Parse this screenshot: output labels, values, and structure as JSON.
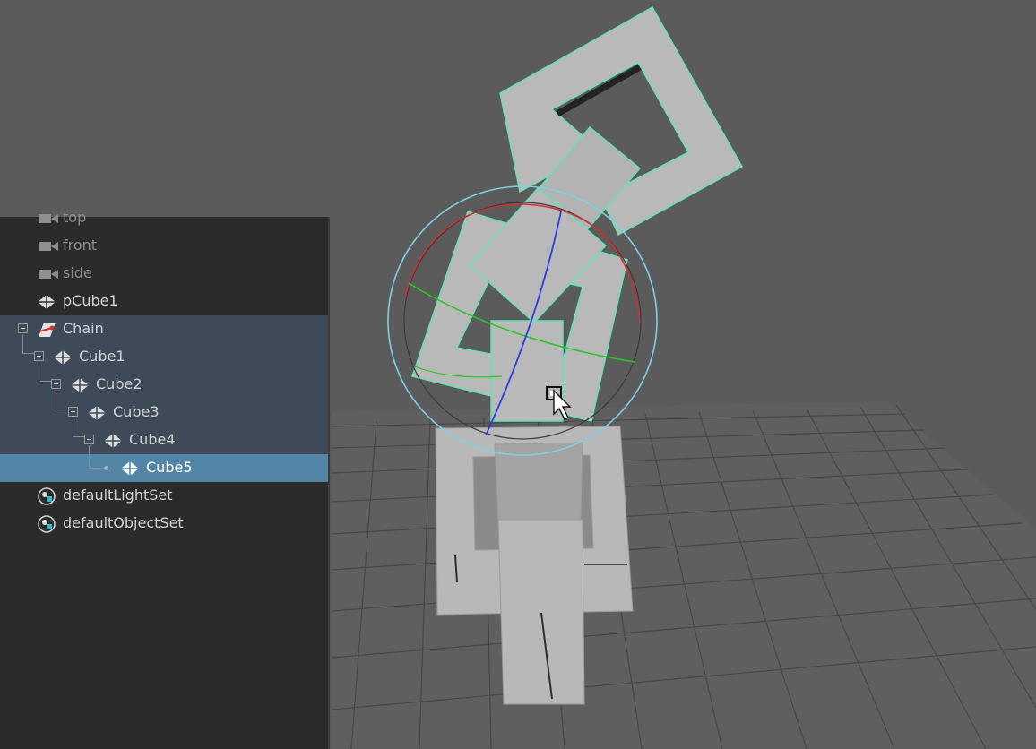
{
  "viewport": {
    "label": "3D perspective viewport",
    "colors": {
      "background": "#5b5b5b",
      "grid": "#444444",
      "geometry": "#b9b9b9",
      "selection_wire": "#5fe6b4",
      "manipulator_outer": "#7fd0e6",
      "rotate_x_axis": "#d03030",
      "rotate_y_axis": "#25c825",
      "rotate_z_axis": "#2b3de0"
    }
  },
  "outliner": {
    "items": [
      {
        "label": "top",
        "icon": "camera-icon",
        "depth": 0,
        "state": "dim"
      },
      {
        "label": "front",
        "icon": "camera-icon",
        "depth": 0,
        "state": "dim"
      },
      {
        "label": "side",
        "icon": "camera-icon",
        "depth": 0,
        "state": "dim"
      },
      {
        "label": "pCube1",
        "icon": "mesh-icon",
        "depth": 0,
        "state": "normal"
      },
      {
        "label": "Chain",
        "icon": "ik-handle-icon",
        "depth": 0,
        "state": "grouped",
        "expanded": true
      },
      {
        "label": "Cube1",
        "icon": "mesh-icon",
        "depth": 1,
        "state": "grouped",
        "expanded": true
      },
      {
        "label": "Cube2",
        "icon": "mesh-icon",
        "depth": 2,
        "state": "grouped",
        "expanded": true
      },
      {
        "label": "Cube3",
        "icon": "mesh-icon",
        "depth": 3,
        "state": "grouped",
        "expanded": true
      },
      {
        "label": "Cube4",
        "icon": "mesh-icon",
        "depth": 4,
        "state": "grouped",
        "expanded": true
      },
      {
        "label": "Cube5",
        "icon": "mesh-icon",
        "depth": 5,
        "state": "selected"
      },
      {
        "label": "defaultLightSet",
        "icon": "set-icon",
        "depth": 0,
        "state": "normal"
      },
      {
        "label": "defaultObjectSet",
        "icon": "set-icon",
        "depth": 0,
        "state": "normal"
      }
    ]
  }
}
